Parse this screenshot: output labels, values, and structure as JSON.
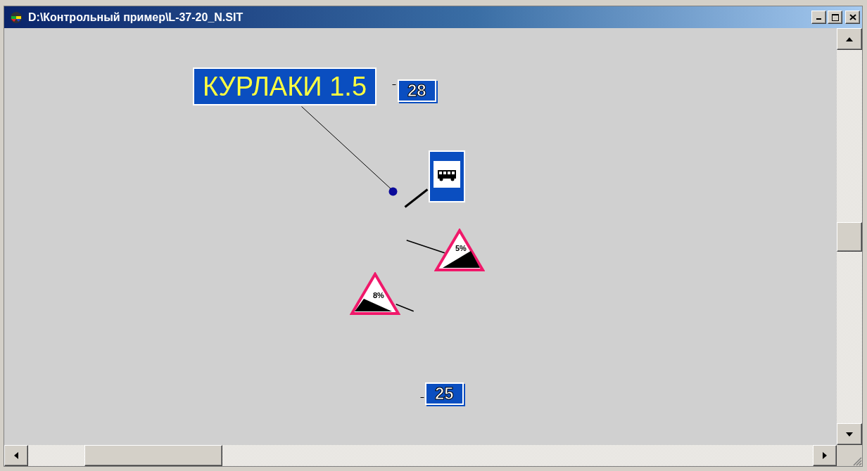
{
  "window": {
    "title": "D:\\Контрольный пример\\L-37-20_N.SIT"
  },
  "map": {
    "place_label": "КУРЛАКИ 1.5",
    "markers": [
      {
        "kind": "number",
        "text": "28"
      },
      {
        "kind": "bus-stop"
      },
      {
        "kind": "slope",
        "text": "5%"
      },
      {
        "kind": "slope",
        "text": "8%"
      },
      {
        "kind": "number",
        "text": "25"
      }
    ]
  }
}
